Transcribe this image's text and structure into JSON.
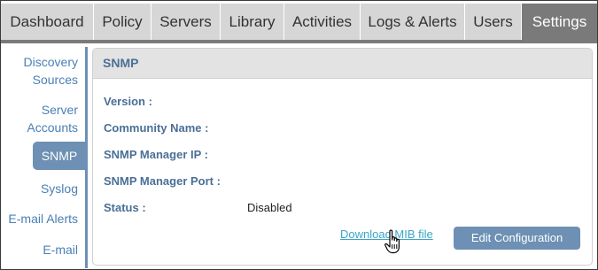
{
  "nav": {
    "tabs": [
      {
        "label": "Dashboard"
      },
      {
        "label": "Policy"
      },
      {
        "label": "Servers"
      },
      {
        "label": "Library"
      },
      {
        "label": "Activities"
      },
      {
        "label": "Logs & Alerts"
      },
      {
        "label": "Users"
      },
      {
        "label": "Settings",
        "active": true
      }
    ]
  },
  "sidebar": {
    "items": [
      {
        "label": "Discovery Sources"
      },
      {
        "label": "Server Accounts"
      },
      {
        "label": "SNMP",
        "active": true
      },
      {
        "label": "Syslog"
      },
      {
        "label": "E-mail Alerts"
      },
      {
        "label": "E-mail"
      }
    ]
  },
  "panel": {
    "title": "SNMP",
    "fields": [
      {
        "label": "Version :",
        "value": ""
      },
      {
        "label": "Community Name :",
        "value": ""
      },
      {
        "label": "SNMP Manager IP :",
        "value": ""
      },
      {
        "label": "SNMP Manager Port :",
        "value": ""
      },
      {
        "label": "Status :",
        "value": "Disabled"
      }
    ],
    "download_link": "Download MIB file",
    "edit_button": "Edit Configuration"
  },
  "colors": {
    "accent": "#6d90b4",
    "tab_active": "#7a7a7a",
    "tab_inactive": "#d6d6d6",
    "link": "#3aa6c8"
  },
  "icons": {
    "cursor": "hand-pointer-icon"
  }
}
